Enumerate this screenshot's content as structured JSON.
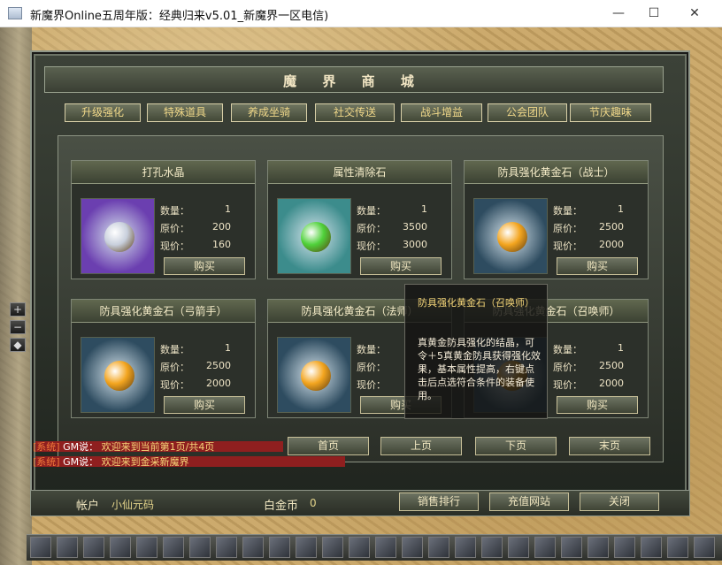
{
  "window": {
    "title": "新魔界Online五周年版：经典归来v5.01_新魔界一区电信)",
    "minimize": "—",
    "maximize": "☐",
    "close": "✕"
  },
  "shop": {
    "title": "魔 界 商 城",
    "tabs": [
      "升级强化",
      "特殊道具",
      "养成坐骑",
      "社交传送",
      "战斗增益",
      "公会团队",
      "节庆趣味"
    ],
    "labels": {
      "qty": "数量：",
      "orig": "原价：",
      "now": "现价：",
      "buy": "购买"
    },
    "items": [
      {
        "name": "打孔水晶",
        "qty": "1",
        "orig": "200",
        "now": "160",
        "gem_color": "#c8cfdc",
        "bg_color": "#6b3fb0"
      },
      {
        "name": "属性清除石",
        "qty": "1",
        "orig": "3500",
        "now": "3000",
        "gem_color": "#4fd13a",
        "bg_color": "#3c8c8c"
      },
      {
        "name": "防具强化黄金石（战士）",
        "qty": "1",
        "orig": "2500",
        "now": "2000",
        "gem_color": "#f3a51f",
        "bg_color": "#2e4c60"
      },
      {
        "name": "防具强化黄金石（弓箭手）",
        "qty": "1",
        "orig": "2500",
        "now": "2000",
        "gem_color": "#f3a51f",
        "bg_color": "#2e4c60"
      },
      {
        "name": "防具强化黄金石（法师）",
        "qty": "",
        "orig": "",
        "now": "",
        "gem_color": "#f3a51f",
        "bg_color": "#2e4c60"
      },
      {
        "name": "防具强化黄金石（召唤师）",
        "qty": "1",
        "orig": "2500",
        "now": "2000",
        "gem_color": "#f3a51f",
        "bg_color": "#2e4c60"
      }
    ],
    "pager": [
      "首页",
      "上页",
      "下页",
      "末页"
    ],
    "tooltip": {
      "title": "防具强化黄金石（召唤师）",
      "desc": "真黄金防具强化的结晶，可令＋5真黄金防具获得强化效果，基本属性提高，右键点击后点选符合条件的装备使用。"
    },
    "account_label": "帐户",
    "account_value": "小仙元码",
    "platinum_label": "白金币",
    "platinum_value": "0",
    "bottom_buttons": [
      "销售排行",
      "充值网站",
      "关闭"
    ]
  },
  "chat": [
    {
      "prefix": "[系统]",
      "sender": "GM说：",
      "text": "欢迎来到当前第1页/共4页"
    },
    {
      "prefix": "[系统]",
      "sender": "GM说：",
      "text": "欢迎来到金采新魔界"
    }
  ],
  "side_buttons": [
    "+",
    "−",
    "◆"
  ],
  "colors": {
    "gold": "#f0d889",
    "frame": "#3c4238",
    "chat_red": "#8f1f1f"
  }
}
